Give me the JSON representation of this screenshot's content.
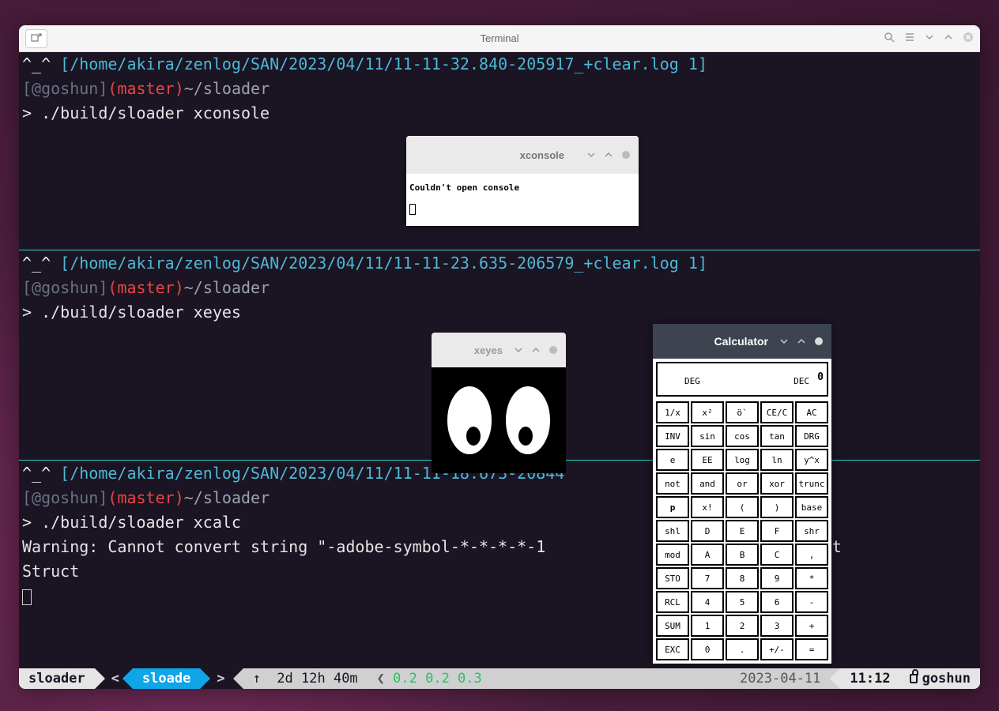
{
  "window": {
    "title": "Terminal"
  },
  "panes": [
    {
      "face": "^_^",
      "log_path": "/home/akira/zenlog/SAN/2023/04/11/11-11-32.840-205917_+clear.log",
      "log_num": "1",
      "host": "@goshun",
      "branch": "master",
      "cwd": "~/sloader",
      "prompt": ">",
      "command": "./build/sloader xconsole"
    },
    {
      "face": "^_^",
      "log_path": "/home/akira/zenlog/SAN/2023/04/11/11-11-23.635-206579_+clear.log",
      "log_num": "1",
      "host": "@goshun",
      "branch": "master",
      "cwd": "~/sloader",
      "prompt": ">",
      "command": "./build/sloader xeyes"
    },
    {
      "face": "^_^",
      "log_path": "/home/akira/zenlog/SAN/2023/04/11/11-11-18.673-20844",
      "log_num": "",
      "host": "@goshun",
      "branch": "master",
      "cwd": "~/sloader",
      "prompt": ">",
      "command": "./build/sloader xcalc",
      "output1": "Warning: Cannot convert string \"-adobe-symbol-*-*-*-*-1",
      "output2": " to type Font",
      "output3": "Struct"
    }
  ],
  "xconsole": {
    "title": "xconsole",
    "message": "Couldn't open console"
  },
  "xeyes": {
    "title": "xeyes"
  },
  "calculator": {
    "title": "Calculator",
    "display": "0",
    "mode_deg": "DEG",
    "mode_dec": "DEC",
    "buttons": [
      "1/x",
      "x²",
      "ö`",
      "CE/C",
      "AC",
      "INV",
      "sin",
      "cos",
      "tan",
      "DRG",
      "e",
      "EE",
      "log",
      "ln",
      "y^x",
      "not",
      "and",
      "or",
      "xor",
      "trunc",
      "p",
      "x!",
      "(",
      ")",
      "base",
      "shl",
      "D",
      "E",
      "F",
      "shr",
      "mod",
      "A",
      "B",
      "C",
      ",",
      "STO",
      "7",
      "8",
      "9",
      "*",
      "RCL",
      "4",
      "5",
      "6",
      "-",
      "SUM",
      "1",
      "2",
      "3",
      "+",
      "EXC",
      "0",
      ".",
      "+/-",
      "="
    ]
  },
  "statusbar": {
    "left1": "sloader",
    "left_angle": "<",
    "left2": "sloade",
    "right_angle": ">",
    "uptime_arrow": "↑",
    "uptime": "2d 12h 40m",
    "load_angle": "❮",
    "load": "0.2 0.2 0.3",
    "date": "2023-04-11",
    "time": "11:12",
    "host": "goshun"
  }
}
